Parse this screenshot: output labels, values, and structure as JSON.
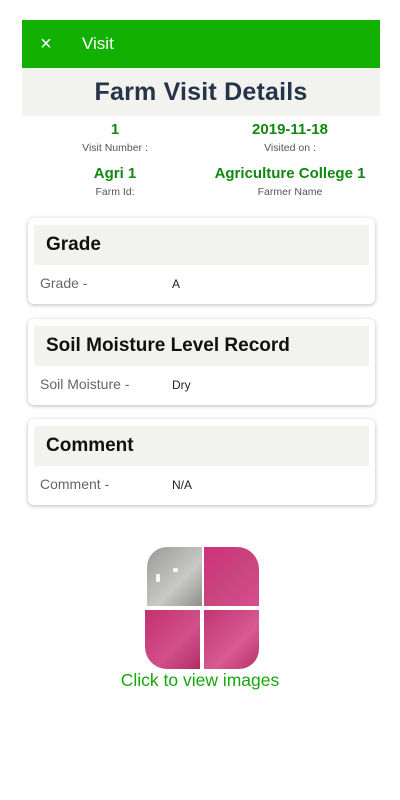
{
  "appbar": {
    "close_icon": "close-icon",
    "close_glyph": "×",
    "title": "Visit",
    "color": "#12b000"
  },
  "header": {
    "title": "Farm Visit Details"
  },
  "info": {
    "visit_number": {
      "value": "1",
      "label": "Visit Number :"
    },
    "visited_on": {
      "value": "2019-11-18",
      "label": "Visited on :"
    },
    "farm_id": {
      "value": "Agri 1",
      "label": "Farm Id:"
    },
    "farmer_name": {
      "value": "Agriculture College 1",
      "label": "Farmer Name"
    }
  },
  "cards": {
    "grade": {
      "title": "Grade",
      "label": "Grade -",
      "value": "A"
    },
    "soil": {
      "title": "Soil Moisture Level Record",
      "label": "Soil Moisture -",
      "value": "Dry"
    },
    "comment": {
      "title": "Comment",
      "label": "Comment -",
      "value": "N/A"
    }
  },
  "images": {
    "link_text": "Click to view images",
    "link_color": "#17a80d"
  },
  "colors": {
    "value_green": "#118811",
    "panel_bg": "#f2f2ee",
    "title_navy": "#26344a"
  }
}
